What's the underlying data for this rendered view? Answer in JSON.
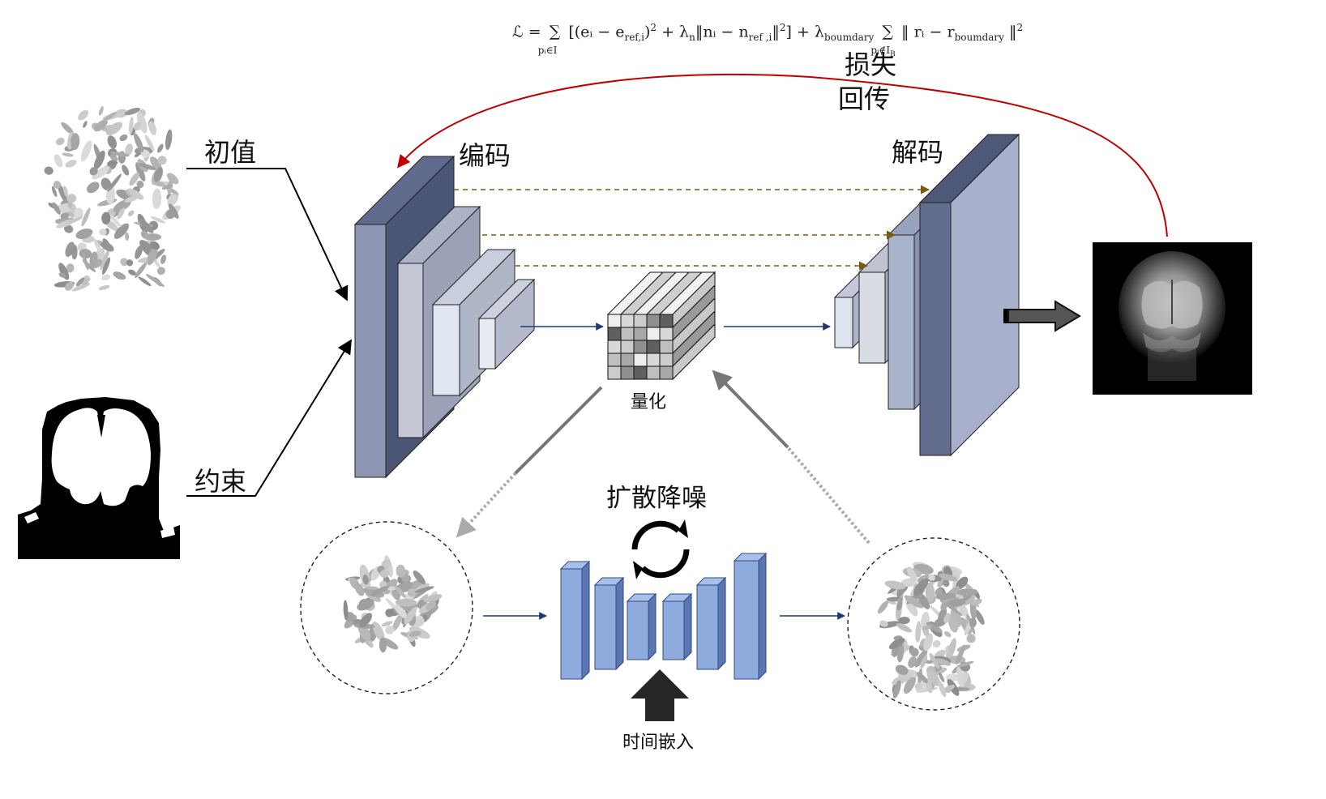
{
  "labels": {
    "initial": "初值",
    "constraint": "约束",
    "encode": "编码",
    "decode": "解码",
    "loss_line1": "损失",
    "loss_line2": "回传",
    "quantize": "量化",
    "diffusion": "扩散降噪",
    "time_embed": "时间嵌入"
  },
  "formula": {
    "lhs": "ℒ =",
    "sum1_sub": "pᵢ∈I",
    "term1": "[(eᵢ − e",
    "term1_sub": "ref,i",
    "term1_b": ")",
    "term1_c": " + λ",
    "term1_c_sub": "n",
    "term1_d": "‖nᵢ − n",
    "term1_d_sub": "ref ,i",
    "term1_e": "‖",
    "term1_f": "] + λ",
    "term1_f_sub": "boumdary",
    "sum2_sub": "pᵢ∉I",
    "sum2_sub_b": "B",
    "term2": "‖ rᵢ − r",
    "term2_sub": "boumdary",
    "term2_b": " ‖",
    "sup2": "2"
  },
  "colors": {
    "loss_arc": "#c00000",
    "skip_arrow": "#7a5a10",
    "flow_arrow": "#1f3a6e",
    "encoder_front": "#8d97b4",
    "encoder_side": "#4b5575",
    "unet_front": "#8faadc",
    "unet_side": "#5b76b0"
  },
  "icons": {
    "cycle": "cycle-arrows-icon",
    "up_arrow": "thick-up-arrow-icon",
    "output_arrow": "thick-right-arrow-icon"
  }
}
